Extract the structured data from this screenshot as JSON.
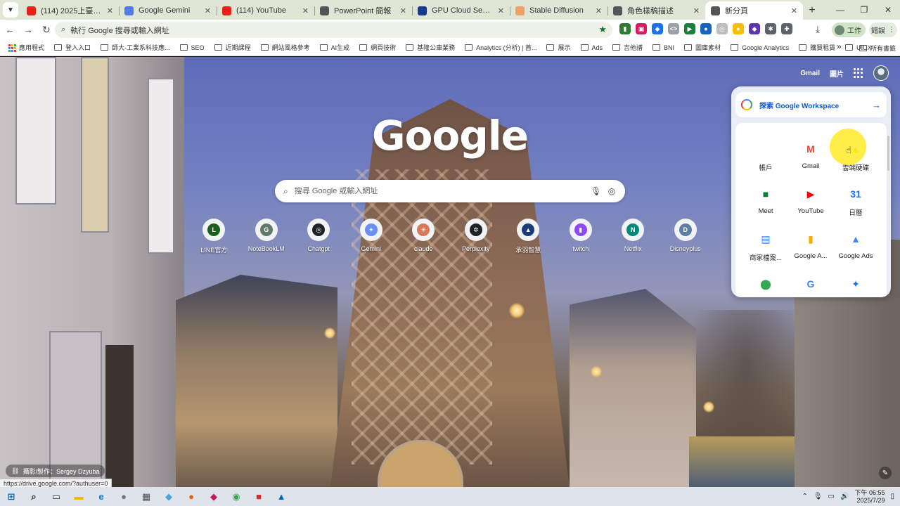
{
  "tabs": [
    {
      "title": "(114) 2025上臺投-AI數位",
      "favicon_color": "#e62117",
      "active": false
    },
    {
      "title": "Google Gemini",
      "favicon_color": "#4f7be8",
      "active": false
    },
    {
      "title": "(114) YouTube",
      "favicon_color": "#e62117",
      "active": false
    },
    {
      "title": "PowerPoint 簡報",
      "favicon_color": "#555555",
      "active": false
    },
    {
      "title": "GPU Cloud Server | Sail",
      "favicon_color": "#1a3a8a",
      "active": false
    },
    {
      "title": "Stable Diffusion",
      "favicon_color": "#f0a060",
      "active": false
    },
    {
      "title": "角色樣稿描述",
      "favicon_color": "#555555",
      "active": false
    },
    {
      "title": "新分頁",
      "favicon_color": "#555555",
      "active": true
    }
  ],
  "toolbar": {
    "omnibox_placeholder": "執行 Google 搜尋或輸入網址",
    "profile_label": "工作",
    "sync_label": "錯誤"
  },
  "extensions": [
    {
      "name": "ext-chart-icon",
      "color": "#2e7d32",
      "glyph": "▮"
    },
    {
      "name": "ext-pink-icon",
      "color": "#d81b60",
      "glyph": "▣"
    },
    {
      "name": "ext-tag-icon",
      "color": "#1a73e8",
      "glyph": "◆"
    },
    {
      "name": "ext-html-icon",
      "color": "#9aa0a6",
      "glyph": "<>"
    },
    {
      "name": "ext-flag-icon",
      "color": "#188038",
      "glyph": "▶"
    },
    {
      "name": "ext-circle-icon",
      "color": "#1565c0",
      "glyph": "●"
    },
    {
      "name": "ext-grey-icon",
      "color": "#bdbdbd",
      "glyph": "◎"
    },
    {
      "name": "ext-color-icon",
      "color": "#fbbc04",
      "glyph": "●"
    },
    {
      "name": "ext-purple-icon",
      "color": "#5e35b1",
      "glyph": "◆"
    },
    {
      "name": "ext-gear-icon",
      "color": "#5f6368",
      "glyph": "✱"
    },
    {
      "name": "ext-puzzle-icon",
      "color": "#5f6368",
      "glyph": "✚"
    }
  ],
  "bookmarks": {
    "apps": "應用程式",
    "items": [
      "登入入口",
      "師大-工業系科技應...",
      "SEO",
      "近期課程",
      "網站風格參考",
      "AI生成",
      "網頁技術",
      "基隆公車業務",
      "Analytics (分析) | 首...",
      "展示",
      "Ads",
      "吉他譜",
      "BNI",
      "圖庫素材",
      "Google Analytics",
      "購買租賃",
      "UIUX"
    ],
    "all_bookmarks": "所有書籤"
  },
  "ntp": {
    "gmail": "Gmail",
    "images": "圖片",
    "logo": "Google",
    "search_placeholder": "搜尋 Google 或輸入網址",
    "photo_credit": "攝影/製作：Sergey Dzyuba"
  },
  "shortcuts": [
    {
      "label": "LINE官方",
      "initial": "L",
      "color": "#1b5e20"
    },
    {
      "label": "NoteBookLM",
      "initial": "G",
      "color": "#5f7a6b"
    },
    {
      "label": "Chatgpt",
      "initial": "◎",
      "color": "#202124"
    },
    {
      "label": "Gemini",
      "initial": "✦",
      "color": "#6c8ef5"
    },
    {
      "label": "claude",
      "initial": "✳",
      "color": "#d97757"
    },
    {
      "label": "Perplexity",
      "initial": "✲",
      "color": "#202124"
    },
    {
      "label": "承羽智慧",
      "initial": "▲",
      "color": "#1a3a7a"
    },
    {
      "label": "twitch",
      "initial": "▮",
      "color": "#9146ff"
    },
    {
      "label": "Netflix",
      "initial": "N",
      "color": "#00897b"
    },
    {
      "label": "Disneyplus",
      "initial": "D",
      "color": "#5c7fa6"
    }
  ],
  "apps_panel": {
    "workspace_label": "探索 Google Workspace",
    "apps": [
      {
        "label": "帳戶",
        "glyph": "",
        "color": "#ffffff"
      },
      {
        "label": "Gmail",
        "glyph": "M",
        "color": "#ea4335"
      },
      {
        "label": "雲端硬碟",
        "glyph": "▲",
        "color": "#fbbc04"
      },
      {
        "label": "Meet",
        "glyph": "■",
        "color": "#00832d"
      },
      {
        "label": "YouTube",
        "glyph": "▶",
        "color": "#ff0000"
      },
      {
        "label": "日曆",
        "glyph": "31",
        "color": "#1a73e8"
      },
      {
        "label": "商家檔案...",
        "glyph": "▤",
        "color": "#4285f4"
      },
      {
        "label": "Google A...",
        "glyph": "▮",
        "color": "#f9ab00"
      },
      {
        "label": "Google Ads",
        "glyph": "▲",
        "color": "#4285f4"
      },
      {
        "label": "",
        "glyph": "⬤",
        "color": "#34a853"
      },
      {
        "label": "",
        "glyph": "G",
        "color": "#4285f4"
      },
      {
        "label": "",
        "glyph": "✦",
        "color": "#1a73e8"
      }
    ]
  },
  "status_url": "https://drive.google.com/?authuser=0",
  "taskbar": {
    "apps": [
      {
        "name": "start-button",
        "glyph": "⊞",
        "color": "#0067c0"
      },
      {
        "name": "search-icon",
        "glyph": "⌕",
        "color": "#333333"
      },
      {
        "name": "task-view-icon",
        "glyph": "▭",
        "color": "#333333"
      },
      {
        "name": "file-explorer-icon",
        "glyph": "▬",
        "color": "#f2b705"
      },
      {
        "name": "edge-icon",
        "glyph": "e",
        "color": "#0c7cd5"
      },
      {
        "name": "app-grey-icon",
        "glyph": "●",
        "color": "#6b7a8a"
      },
      {
        "name": "calculator-icon",
        "glyph": "▦",
        "color": "#505050"
      },
      {
        "name": "notes-icon",
        "glyph": "◆",
        "color": "#4aa3df"
      },
      {
        "name": "firefox-icon",
        "glyph": "●",
        "color": "#e66000"
      },
      {
        "name": "app-pink-icon",
        "glyph": "◆",
        "color": "#c2185b"
      },
      {
        "name": "chrome-icon",
        "glyph": "◉",
        "color": "#34a853"
      },
      {
        "name": "app-red-icon",
        "glyph": "■",
        "color": "#d32f2f"
      },
      {
        "name": "photos-icon",
        "glyph": "▲",
        "color": "#0067c0"
      }
    ],
    "time": "下午 06:55",
    "date": "2025/7/29"
  }
}
